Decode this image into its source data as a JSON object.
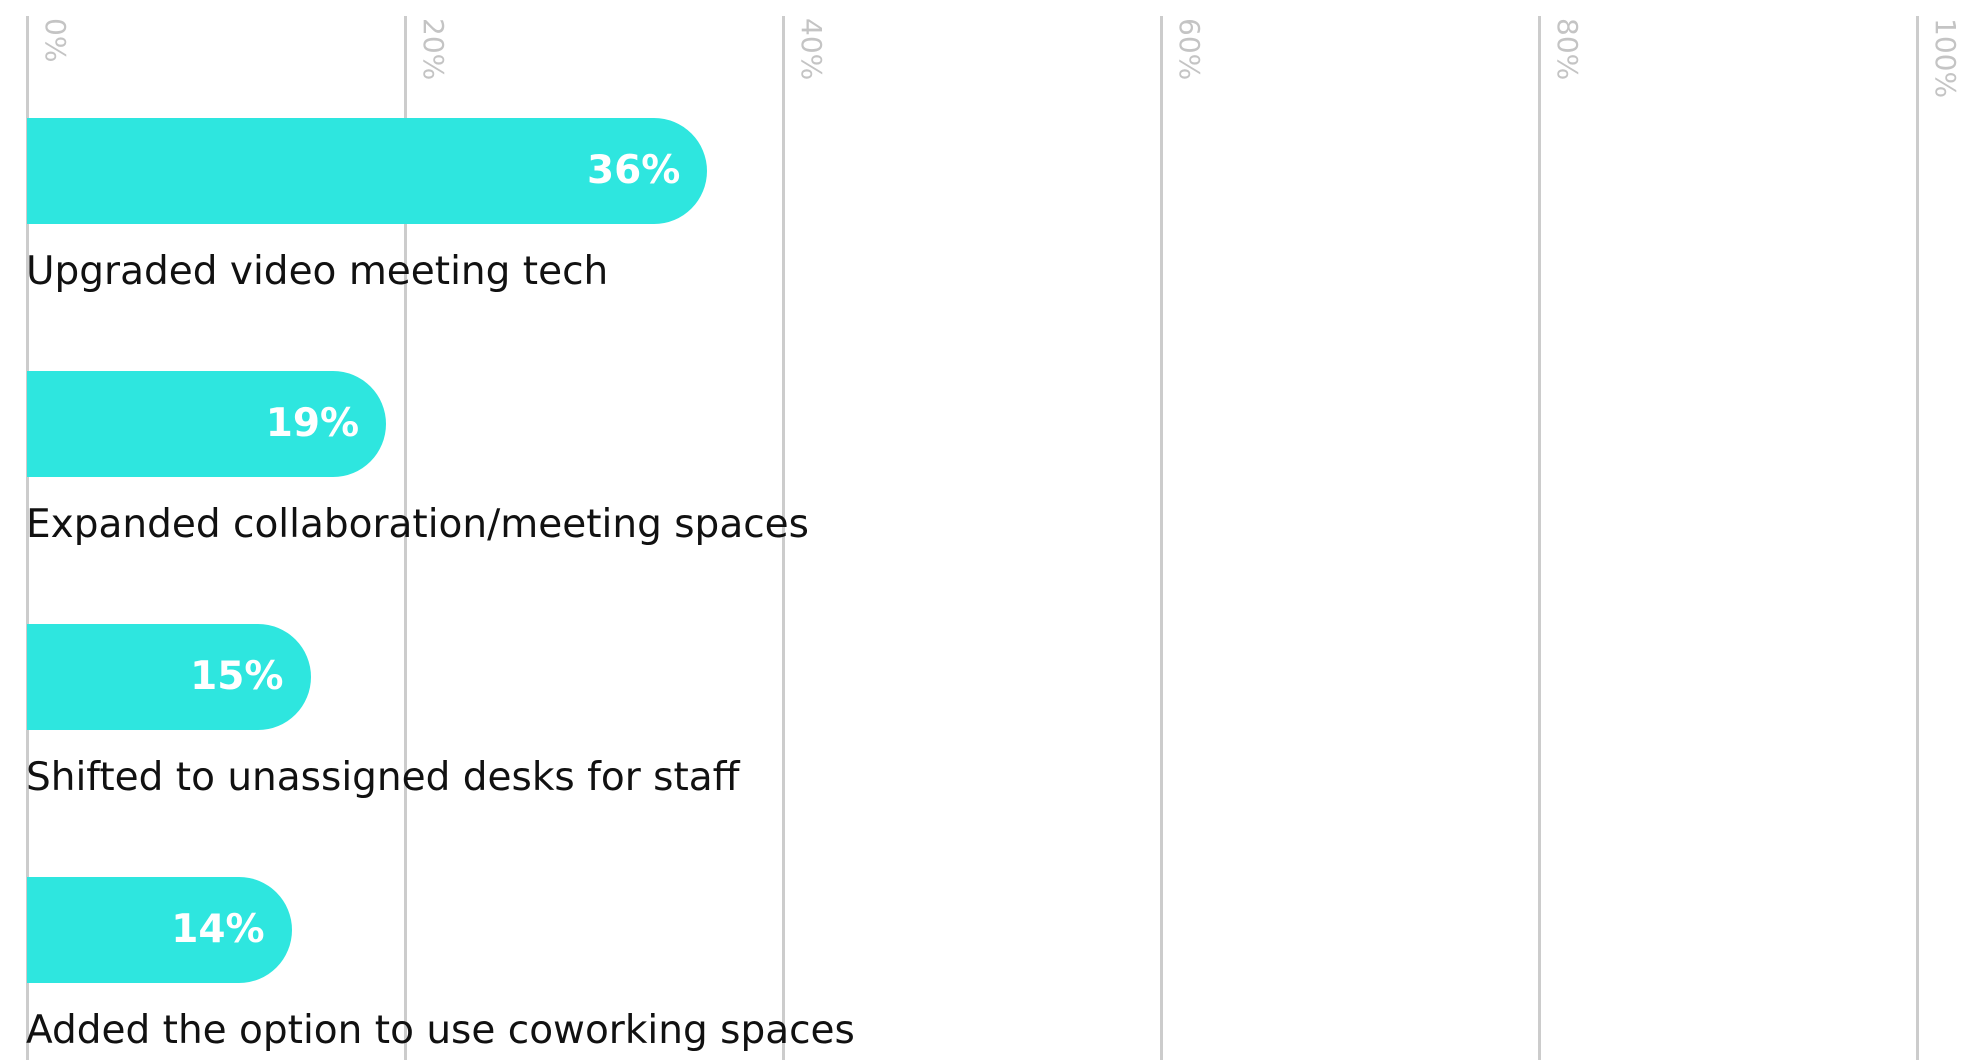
{
  "chart_data": {
    "type": "bar",
    "orientation": "horizontal",
    "categories": [
      "Upgraded video meeting tech",
      "Expanded collaboration/meeting spaces",
      "Shifted to unassigned desks for staff",
      "Added the option to use coworking spaces"
    ],
    "values": [
      36,
      19,
      15,
      14
    ],
    "value_labels": [
      "36%",
      "19%",
      "15%",
      "14%"
    ],
    "xlim": [
      0,
      100
    ],
    "x_ticks": [
      0,
      20,
      40,
      60,
      80,
      100
    ],
    "x_tick_labels": [
      "0%",
      "20%",
      "40%",
      "60%",
      "80%",
      "100%"
    ],
    "grid": true,
    "colors": {
      "bar": "#2ee6df",
      "value_text": "#ffffff",
      "grid": "#cccccc",
      "tick_text": "#c4c4c4",
      "category_text": "#111111"
    }
  }
}
